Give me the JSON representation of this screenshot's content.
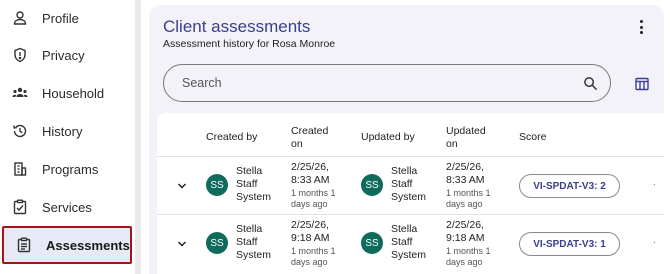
{
  "sidebar": {
    "items": [
      {
        "label": "Profile",
        "icon": "person-icon"
      },
      {
        "label": "Privacy",
        "icon": "shield-icon"
      },
      {
        "label": "Household",
        "icon": "group-icon"
      },
      {
        "label": "History",
        "icon": "history-icon"
      },
      {
        "label": "Programs",
        "icon": "building-icon"
      },
      {
        "label": "Services",
        "icon": "clipboard-check-icon"
      },
      {
        "label": "Assessments",
        "icon": "clipboard-list-icon",
        "active": true
      }
    ]
  },
  "card": {
    "title": "Client assessments",
    "subtitle": "Assessment history for Rosa Monroe"
  },
  "search": {
    "placeholder": "Search",
    "value": ""
  },
  "table": {
    "headers": {
      "created_by": "Created by",
      "created_on_1": "Created",
      "created_on_2": "on",
      "updated_by": "Updated by",
      "updated_on_1": "Updated",
      "updated_on_2": "on",
      "score": "Score"
    },
    "rows": [
      {
        "created_by_initials": "SS",
        "created_by_1": "Stella",
        "created_by_2": "Staff",
        "created_by_3": "System",
        "created_on_1": "2/25/26,",
        "created_on_2": "8:33 AM",
        "created_rel_1": "1 months 1",
        "created_rel_2": "days ago",
        "updated_by_initials": "SS",
        "updated_by_1": "Stella",
        "updated_by_2": "Staff",
        "updated_by_3": "System",
        "updated_on_1": "2/25/26,",
        "updated_on_2": "8:33 AM",
        "updated_rel_1": "1 months 1",
        "updated_rel_2": "days ago",
        "score": "VI-SPDAT-V3: 2"
      },
      {
        "created_by_initials": "SS",
        "created_by_1": "Stella",
        "created_by_2": "Staff",
        "created_by_3": "System",
        "created_on_1": "2/25/26,",
        "created_on_2": "9:18 AM",
        "created_rel_1": "1 months 1",
        "created_rel_2": "days ago",
        "updated_by_initials": "SS",
        "updated_by_1": "Stella",
        "updated_by_2": "Staff",
        "updated_by_3": "System",
        "updated_on_1": "2/25/26,",
        "updated_on_2": "9:18 AM",
        "updated_rel_1": "1 months 1",
        "updated_rel_2": "days ago",
        "score": "VI-SPDAT-V3: 1"
      }
    ]
  },
  "colors": {
    "accent": "#3b3f8f",
    "avatar": "#0f6b5c",
    "active_outline": "#a31515",
    "active_bg": "#e7eaf6"
  }
}
